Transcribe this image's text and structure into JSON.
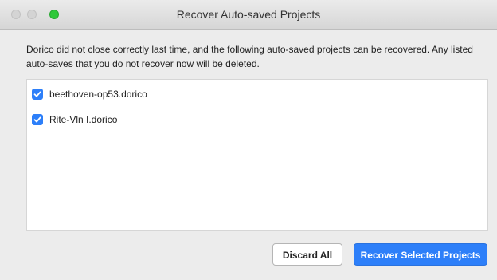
{
  "window": {
    "title": "Recover Auto-saved Projects"
  },
  "dialog": {
    "message": "Dorico did not close correctly last time, and the following auto-saved projects can be recovered. Any listed auto-saves that you do not recover now will be deleted.",
    "items": [
      {
        "label": "beethoven-op53.dorico",
        "checked": true
      },
      {
        "label": "Rite-Vln I.dorico",
        "checked": true
      }
    ]
  },
  "buttons": {
    "discard_label": "Discard All",
    "recover_label": "Recover Selected Projects"
  },
  "colors": {
    "accent": "#2d7ff9",
    "zoom_button": "#2ec839"
  }
}
